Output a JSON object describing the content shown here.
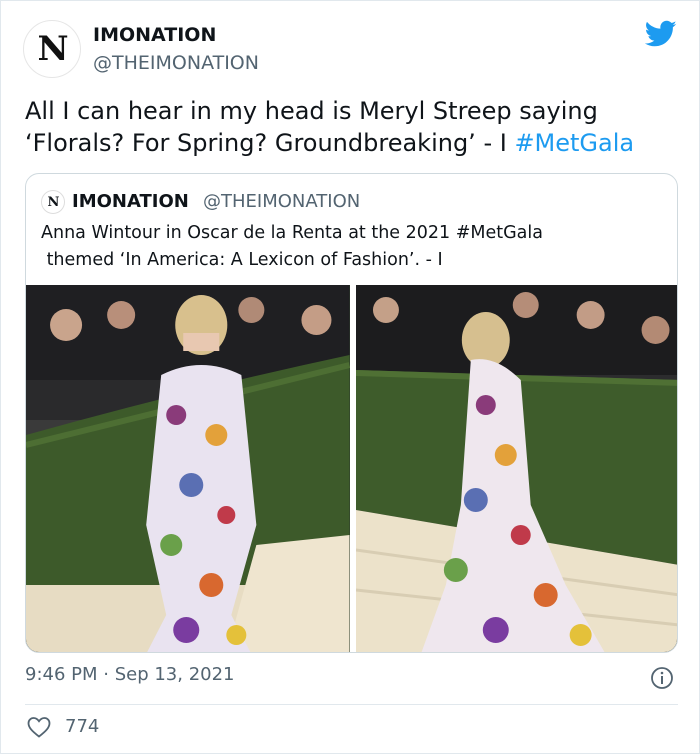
{
  "author": {
    "avatar_text": "N",
    "name": "IMONATION",
    "handle": "@THEIMONATION"
  },
  "tweet": {
    "text": "All I can hear in my head is Meryl Streep saying ‘Florals? For Spring? Groundbreaking’ - I ",
    "hashtag": "#MetGala"
  },
  "quoted": {
    "avatar_text": "N",
    "name": "IMONATION",
    "handle": "@THEIMONATION",
    "line1": "Anna Wintour in Oscar de la Renta at the 2021 #MetGala",
    "line2": " themed ‘In America: A Lexicon of Fashion’. - I"
  },
  "meta": {
    "timestamp": "9:46 PM · Sep 13, 2021",
    "likes": "774"
  },
  "colors": {
    "twitter_blue": "#1d9bf0",
    "text": "#0f1419",
    "secondary": "#536471",
    "border": "#cfd9de"
  },
  "icons": [
    "twitter-bird-icon",
    "info-icon",
    "heart-icon"
  ]
}
